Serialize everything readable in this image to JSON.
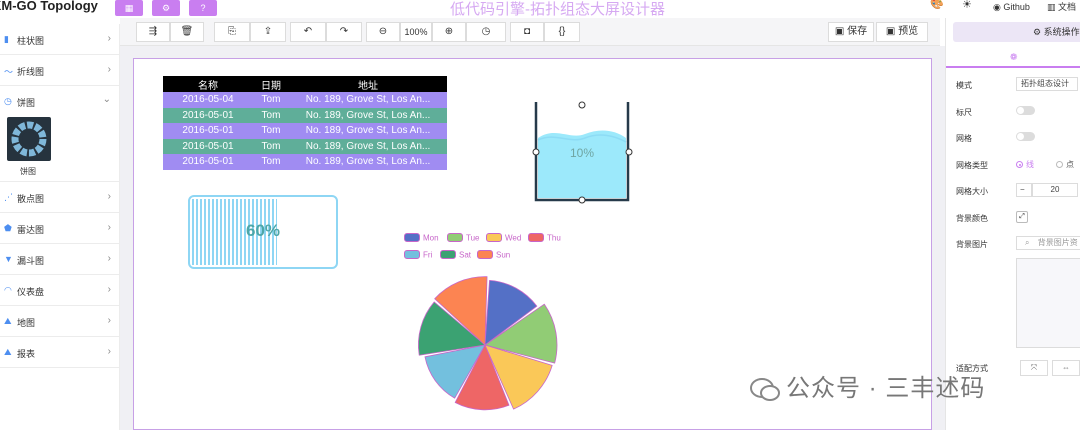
{
  "header": {
    "brand": "KM-GO Topology",
    "app_title": "低代码引擎-拓扑组态大屏设计器",
    "buttons": [
      {
        "icon": "grid-icon",
        "glyph": "▦"
      },
      {
        "icon": "settings-icon",
        "glyph": "⚙"
      },
      {
        "icon": "help-icon",
        "glyph": "?"
      }
    ],
    "right": {
      "theme_icon": "palette-icon",
      "mode_icon": "sun-icon",
      "github_label": "Github",
      "docs_label": "文档"
    }
  },
  "sidebar": {
    "items": [
      {
        "icon": "bar-chart-icon",
        "glyph": "▮",
        "label": "柱状图",
        "expanded": false
      },
      {
        "icon": "line-chart-icon",
        "glyph": "〜",
        "label": "折线图",
        "expanded": false
      },
      {
        "icon": "pie-chart-icon",
        "glyph": "◷",
        "label": "饼图",
        "expanded": true
      },
      {
        "icon": "scatter-chart-icon",
        "glyph": "⋰",
        "label": "散点图",
        "expanded": false
      },
      {
        "icon": "radar-chart-icon",
        "glyph": "⬟",
        "label": "雷达图",
        "expanded": false
      },
      {
        "icon": "funnel-chart-icon",
        "glyph": "▼",
        "label": "漏斗图",
        "expanded": false
      },
      {
        "icon": "gauge-icon",
        "glyph": "◠",
        "label": "仪表盘",
        "expanded": false
      },
      {
        "icon": "map-icon",
        "glyph": "⛰",
        "label": "地图",
        "expanded": false
      },
      {
        "icon": "report-icon",
        "glyph": "⛰",
        "label": "报表",
        "expanded": false
      }
    ],
    "pie_thumb_label": "饼图"
  },
  "toolbar": {
    "zoom_level": "100%",
    "save_label": "保存",
    "preview_label": "预览"
  },
  "table": {
    "headers": [
      "名称",
      "日期",
      "地址"
    ],
    "rows": [
      [
        "2016-05-04",
        "Tom",
        "No. 189, Grove St, Los An..."
      ],
      [
        "2016-05-01",
        "Tom",
        "No. 189, Grove St, Los An..."
      ],
      [
        "2016-05-01",
        "Tom",
        "No. 189, Grove St, Los An..."
      ],
      [
        "2016-05-01",
        "Tom",
        "No. 189, Grove St, Los An..."
      ],
      [
        "2016-05-01",
        "Tom",
        "No. 189, Grove St, Los An..."
      ]
    ]
  },
  "progress": {
    "value": 0.6,
    "label": "60%"
  },
  "beaker": {
    "value": 0.1,
    "label": "10%"
  },
  "chart_data": {
    "type": "pie",
    "variant": "rose",
    "categories": [
      "Mon",
      "Tue",
      "Wed",
      "Thu",
      "Fri",
      "Sat",
      "Sun"
    ],
    "colors": [
      "#5470c6",
      "#91cc75",
      "#fac858",
      "#ee6666",
      "#73c0de",
      "#3ba272",
      "#fc8452"
    ],
    "values": [
      70,
      90,
      85,
      70,
      60,
      75,
      80
    ],
    "title": "",
    "legend_position": "top"
  },
  "right_panel": {
    "tab_label": "系统操作",
    "sub_icon": "gear-icon",
    "fields": {
      "mode_label": "模式",
      "mode_value": "拓扑组态设计",
      "ruler_label": "标尺",
      "grid_label": "网格",
      "grid_type_label": "网格类型",
      "grid_type_options": [
        "线",
        "点"
      ],
      "grid_size_label": "网格大小",
      "grid_size_value": "20",
      "bg_color_label": "背景颜色",
      "bg_image_label": "背景图片",
      "bg_image_placeholder": "背景图片资",
      "fit_label": "适配方式"
    }
  },
  "watermark": {
    "text": "公众号 · 三丰述码"
  }
}
